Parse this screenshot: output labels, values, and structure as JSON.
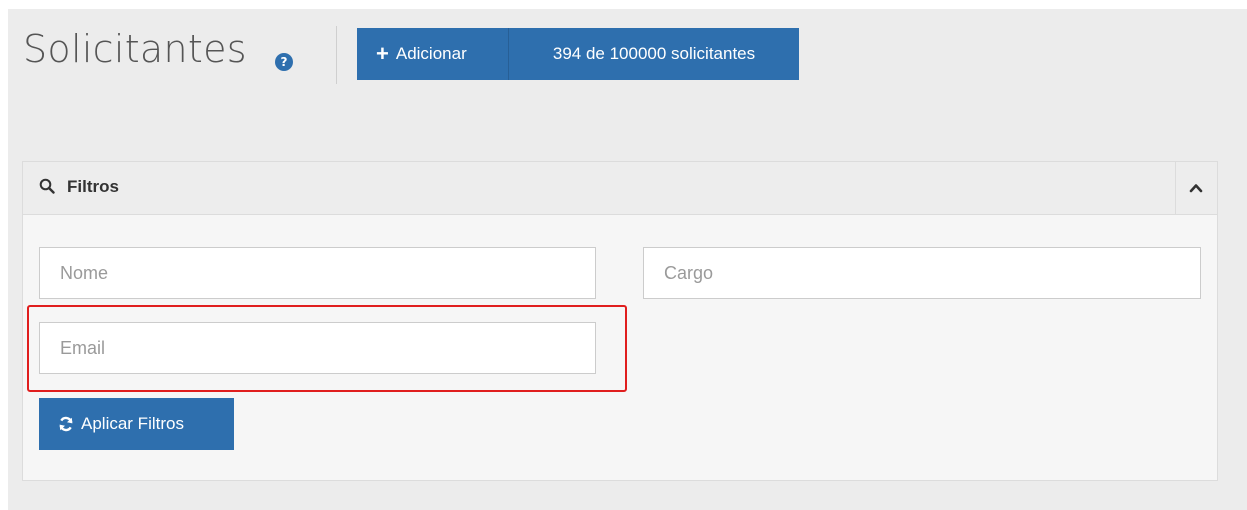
{
  "header": {
    "title": "Solicitantes",
    "help_icon": "question-circle-icon",
    "help_glyph": "?"
  },
  "toolbar": {
    "add_label": "Adicionar",
    "add_icon": "plus-icon",
    "add_glyph": "+",
    "count_label": "394 de 100000 solicitantes"
  },
  "filters": {
    "title": "Filtros",
    "title_icon": "search-icon",
    "collapse_icon": "chevron-up-icon",
    "fields": {
      "nome": {
        "placeholder": "Nome",
        "value": ""
      },
      "cargo": {
        "placeholder": "Cargo",
        "value": ""
      },
      "email": {
        "placeholder": "Email",
        "value": ""
      }
    },
    "apply_label": "Aplicar Filtros",
    "apply_icon": "refresh-icon"
  },
  "colors": {
    "primary": "#2e6fae",
    "highlight": "#e01e1e",
    "background": "#ececec",
    "panel": "#f6f6f6"
  }
}
